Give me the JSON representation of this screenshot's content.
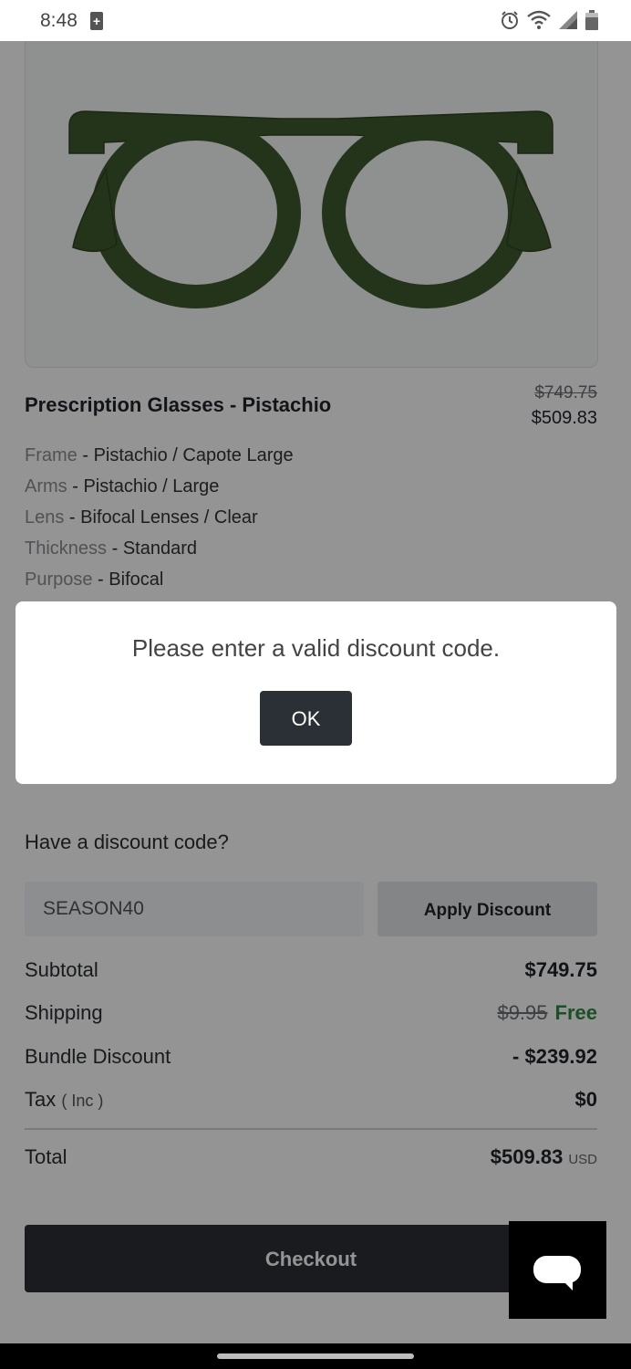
{
  "status_bar": {
    "time": "8:48"
  },
  "product": {
    "title": "Prescription Glasses - Pistachio",
    "price_original": "$749.75",
    "price_current": "$509.83",
    "frame_color": "#3f5a2e",
    "attributes": [
      {
        "key": "Frame",
        "value": "Pistachio / Capote Large"
      },
      {
        "key": "Arms",
        "value": "Pistachio / Large"
      },
      {
        "key": "Lens",
        "value": "Bifocal Lenses / Clear"
      },
      {
        "key": "Thickness",
        "value": "Standard"
      },
      {
        "key": "Purpose",
        "value": "Bifocal"
      }
    ]
  },
  "discount": {
    "question": "Have a discount code?",
    "input_value": "SEASON40",
    "apply_label": "Apply Discount"
  },
  "summary": {
    "subtotal_label": "Subtotal",
    "subtotal_value": "$749.75",
    "shipping_label": "Shipping",
    "shipping_old": "$9.95",
    "shipping_value": "Free",
    "bundle_label": "Bundle Discount",
    "bundle_value": "- $239.92",
    "tax_label": "Tax",
    "tax_note": "( Inc )",
    "tax_value": "$0",
    "total_label": "Total",
    "total_value": "$509.83",
    "currency": "USD"
  },
  "checkout_label": "Checkout",
  "dialog": {
    "message": "Please enter a valid discount code.",
    "ok_label": "OK"
  },
  "colors": {
    "accent_green": "#2e8b3d",
    "dark_button": "#2b3036"
  }
}
